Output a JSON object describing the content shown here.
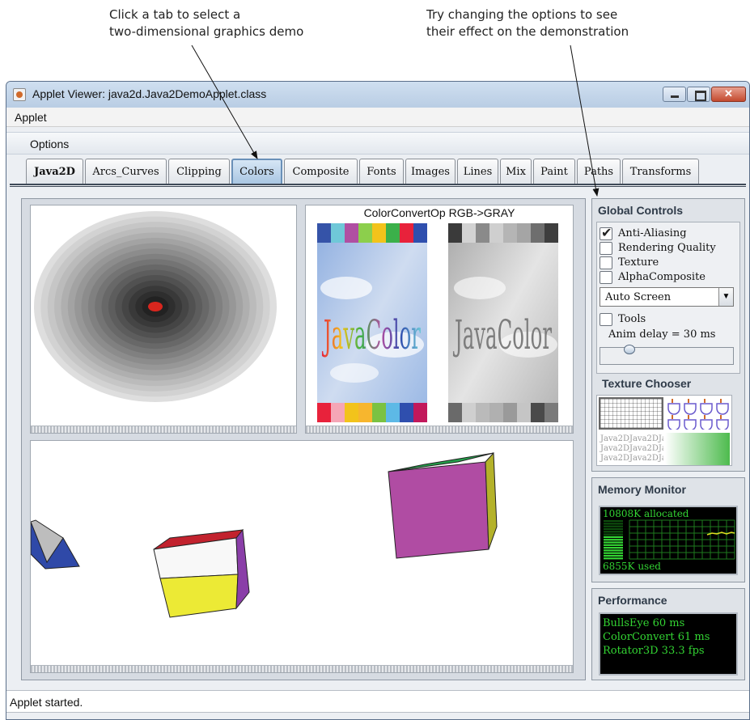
{
  "callouts": {
    "left": [
      "Click a tab to select a",
      "two-dimensional graphics demo"
    ],
    "right": [
      "Try changing the options to see",
      "their effect on the demonstration"
    ]
  },
  "window": {
    "title": "Applet Viewer: java2d.Java2DemoApplet.class",
    "menu": "Applet"
  },
  "options_label": "Options",
  "tabs": [
    {
      "label": "Java2D",
      "bold": true
    },
    {
      "label": "Arcs_Curves"
    },
    {
      "label": "Clipping"
    },
    {
      "label": "Colors",
      "selected": true
    },
    {
      "label": "Composite"
    },
    {
      "label": "Fonts"
    },
    {
      "label": "Images"
    },
    {
      "label": "Lines"
    },
    {
      "label": "Mix"
    },
    {
      "label": "Paint"
    },
    {
      "label": "Paths"
    },
    {
      "label": "Transforms"
    }
  ],
  "colorconvert": {
    "title": "ColorConvertOp RGB->GRAY",
    "image_text": "JavaColor",
    "top_colors": [
      "#3553a8",
      "#6fc8d8",
      "#b04fa2",
      "#8ccf4c",
      "#f2c31b",
      "#3bb04a",
      "#e8223b",
      "#2f4fae"
    ],
    "bottom_colors": [
      "#e8223b",
      "#f5a6b6",
      "#f2c31b",
      "#f7b62e",
      "#7bc242",
      "#5db9e6",
      "#2f4fae",
      "#c2185b"
    ],
    "gray_top": [
      "#3a3a3a",
      "#d2d2d2",
      "#8a8a8a",
      "#cfcfcf",
      "#b5b5b5",
      "#a5a5a5",
      "#6e6e6e",
      "#3e3e3e"
    ],
    "gray_bottom": [
      "#6a6a6a",
      "#cfcfcf",
      "#bababa",
      "#b0b0b0",
      "#9a9a9a",
      "#c5c5c5",
      "#4a4a4a",
      "#7a7a7a"
    ]
  },
  "global_controls": {
    "title": "Global Controls",
    "checkboxes": [
      {
        "label": "Anti-Aliasing",
        "checked": true
      },
      {
        "label": "Rendering Quality",
        "checked": false
      },
      {
        "label": "Texture",
        "checked": false
      },
      {
        "label": "AlphaComposite",
        "checked": false
      }
    ],
    "screen_select": "Auto Screen",
    "tools": {
      "label": "Tools",
      "checked": false
    },
    "anim_delay_label": "Anim delay = 30 ms",
    "anim_delay_fraction": 0.2
  },
  "texture_chooser": {
    "title": "Texture Chooser",
    "text_sample": "Java2DJava2DJava2D"
  },
  "memory_monitor": {
    "title": "Memory Monitor",
    "allocated": "10808K allocated",
    "used": "6855K used",
    "used_fraction": 0.63
  },
  "performance": {
    "title": "Performance",
    "lines": [
      "BullsEye 60 ms",
      "ColorConvert 61 ms",
      "Rotator3D 33.3 fps"
    ]
  },
  "status": "Applet started.",
  "colors": {
    "monitor_green": "#33d433",
    "tab_selected": "#a9c6e2"
  }
}
